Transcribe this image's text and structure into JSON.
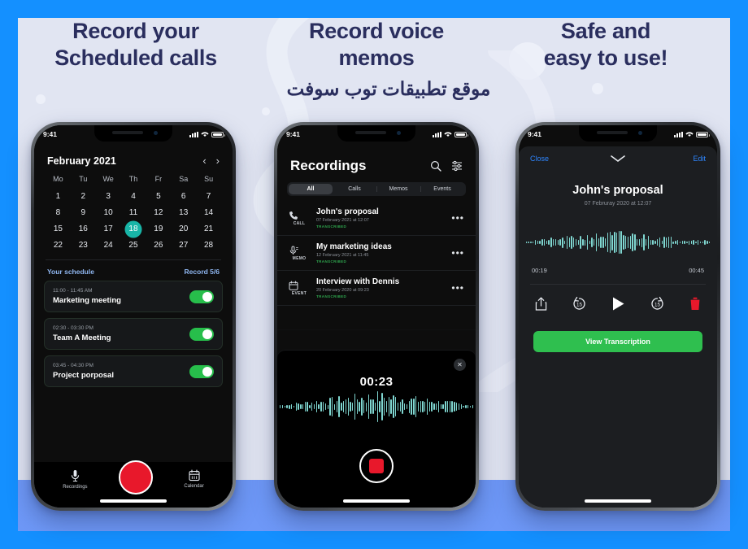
{
  "page": {
    "border_color": "#1490FF",
    "panel_bg": "#E1E5F2",
    "panel_bottom_bg": "#6E98F7",
    "heading_color": "#2A2E5E"
  },
  "headings": {
    "col1": "Record your\nScheduled calls",
    "col1_line1": "Record your",
    "col1_line2": "Scheduled calls",
    "col2_line1": "Record voice",
    "col2_line2": "memos",
    "col3_line1": "Safe and",
    "col3_line2": "easy to use!",
    "arabic_watermark": "موقع تطبيقات توب سوفت"
  },
  "status_bar": {
    "time": "9:41"
  },
  "phone1": {
    "calendar": {
      "title": "February 2021",
      "prev_icon": "chevron-left-icon",
      "next_icon": "chevron-right-icon",
      "weekdays": [
        "Mo",
        "Tu",
        "We",
        "Th",
        "Fr",
        "Sa",
        "Su"
      ],
      "days": [
        1,
        2,
        3,
        4,
        5,
        6,
        7,
        8,
        9,
        10,
        11,
        12,
        13,
        14,
        15,
        16,
        17,
        18,
        19,
        20,
        21,
        22,
        23,
        24,
        25,
        26,
        27,
        28
      ],
      "selected_day": 18,
      "selected_color": "#18B5A7"
    },
    "schedule": {
      "label": "Your schedule",
      "record_count": "Record 5/6",
      "accent": "#8FB6F0",
      "items": [
        {
          "time": "11:00 - 11:45 AM",
          "name": "Marketing meeting",
          "enabled": true
        },
        {
          "time": "02:30 - 03:30 PM",
          "name": "Team A Meeting",
          "enabled": true
        },
        {
          "time": "03:45 - 04:30 PM",
          "name": "Project porposal",
          "enabled": true
        }
      ],
      "toggle_color": "#27BE4B"
    },
    "tabbar": {
      "left_label": "Recordings",
      "left_icon": "microphone-icon",
      "record_icon": "record-button",
      "record_color": "#E8182B",
      "right_label": "Calendar",
      "right_icon": "calendar-icon"
    }
  },
  "phone2": {
    "title": "Recordings",
    "search_icon": "search-icon",
    "filter_icon": "sliders-icon",
    "tabs": [
      {
        "label": "All",
        "active": true
      },
      {
        "label": "Calls",
        "active": false
      },
      {
        "label": "Memos",
        "active": false
      },
      {
        "label": "Events",
        "active": false
      }
    ],
    "recordings": [
      {
        "type": "CALL",
        "icon": "phone-icon",
        "title": "John's proposal",
        "date": "07 February 2021 at 12:07",
        "badge": "TRANSCRIBED"
      },
      {
        "type": "MEMO",
        "icon": "microphone-icon",
        "title": "My marketing ideas",
        "date": "12 February 2021 at 11:45",
        "badge": "TRANSCRIBED"
      },
      {
        "type": "EVENT",
        "icon": "calendar-icon",
        "title": "Interview with Dennis",
        "date": "20 February 2020 at 09:23",
        "badge": "TRANSCRIBED"
      }
    ],
    "more_icon": "ellipsis-icon",
    "badge_color": "#2FA84F",
    "overlay": {
      "close_icon": "close-icon",
      "timer": "00:23",
      "stop_icon": "stop-button",
      "stop_color": "#E8182B",
      "wave_color": "#7FD6D0"
    }
  },
  "phone3": {
    "close_label": "Close",
    "edit_label": "Edit",
    "collapse_icon": "chevron-down-icon",
    "title": "John's proposal",
    "date": "07 Februray 2020 at 12:07",
    "time_current": "00:19",
    "time_total": "00:45",
    "controls": [
      {
        "name": "share-icon",
        "label": "share"
      },
      {
        "name": "rewind-15-icon",
        "label": "15"
      },
      {
        "name": "play-icon",
        "label": "play"
      },
      {
        "name": "forward-15-icon",
        "label": "15"
      },
      {
        "name": "delete-icon",
        "label": "delete"
      }
    ],
    "delete_color": "#E8182B",
    "transcription_button": "View Transcription",
    "transcription_color": "#2FBF4F",
    "link_color": "#2E86FF",
    "wave_color": "#7FD6D0"
  }
}
